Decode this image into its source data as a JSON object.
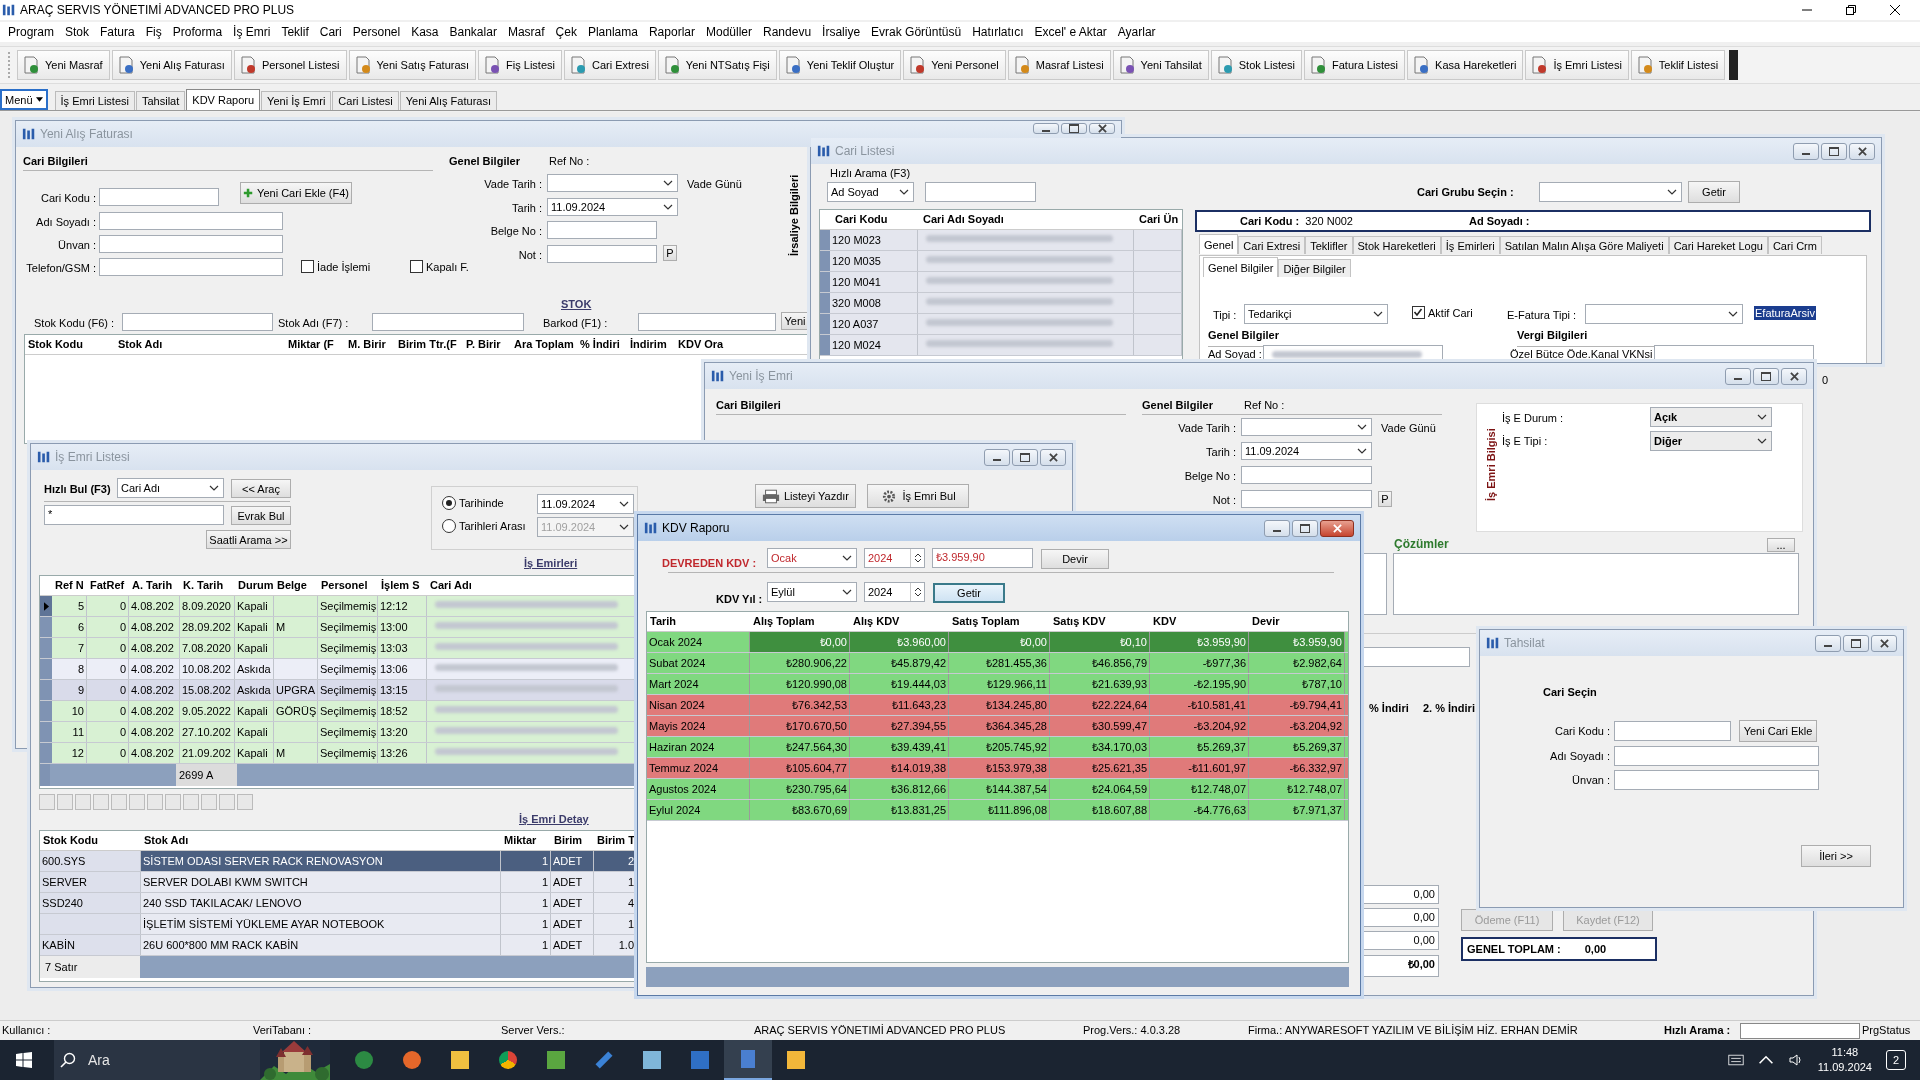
{
  "app_title": "ARAÇ SERVIS YÖNETIMİ ADVANCED PRO PLUS",
  "menu": [
    "Program",
    "Stok",
    "Fatura",
    "Fiş",
    "Proforma",
    "İş Emri",
    "Teklif",
    "Cari",
    "Personel",
    "Kasa",
    "Bankalar",
    "Masraf",
    "Çek",
    "Planlama",
    "Raporlar",
    "Modüller",
    "Randevu",
    "İrsaliye",
    "Evrak Görüntüsü",
    "Hatırlatıcı",
    "Excel' e Aktar",
    "Ayarlar"
  ],
  "toolbar": [
    "Yeni Masraf",
    "Yeni Alış Faturası",
    "Personel Listesi",
    "Yeni Satış Faturası",
    "Fiş Listesi",
    "Cari Extresi",
    "Yeni NTSatış Fişi",
    "Yeni Teklif Oluştur",
    "Yeni Personel",
    "Masraf Listesi",
    "Yeni Tahsilat",
    "Stok Listesi",
    "Fatura Listesi",
    "Kasa Hareketleri",
    "İş Emri Listesi",
    "Teklif Listesi"
  ],
  "menu_button": "Menü",
  "tabs": [
    {
      "label": "İş Emri Listesi",
      "selected": false
    },
    {
      "label": "Tahsilat",
      "selected": false
    },
    {
      "label": "KDV Raporu",
      "selected": true
    },
    {
      "label": "Yeni İş Emri",
      "selected": false
    },
    {
      "label": "Cari Listesi",
      "selected": false
    },
    {
      "label": "Yeni Alış Faturası",
      "selected": false
    }
  ],
  "windows": [
    {
      "kind": "purchase_invoice",
      "title": "Yeni Alış Faturası",
      "active": false,
      "items": [
        {
          "kind": "heading",
          "text": "Cari Bilgileri"
        },
        {
          "kind": "label",
          "text": "Cari Kodu :"
        },
        {
          "kind": "field"
        },
        {
          "kind": "label",
          "text": "Adı Soyadı :"
        },
        {
          "kind": "field"
        },
        {
          "kind": "label",
          "text": "Ünvan :"
        },
        {
          "kind": "field"
        },
        {
          "kind": "label",
          "text": "Telefon/GSM :"
        },
        {
          "kind": "field"
        },
        {
          "kind": "add_button",
          "text": "Yeni Cari Ekle (F4)"
        },
        {
          "kind": "checkbox",
          "text": "İade İşlemi",
          "checked": false
        },
        {
          "kind": "checkbox",
          "text": "Kapalı F.",
          "checked": false
        },
        {
          "kind": "heading",
          "text": "Genel Bilgiler"
        },
        {
          "kind": "label",
          "text": "Ref No :"
        },
        {
          "kind": "label",
          "text": "Vade Tarih :"
        },
        {
          "kind": "dropdown"
        },
        {
          "kind": "label",
          "text": "Vade Günü"
        },
        {
          "kind": "label",
          "text": "Tarih :"
        },
        {
          "kind": "dropdown",
          "value": "11.09.2024"
        },
        {
          "kind": "label",
          "text": "Belge No :"
        },
        {
          "kind": "field"
        },
        {
          "kind": "label",
          "text": "Not :"
        },
        {
          "kind": "field"
        },
        {
          "kind": "button",
          "text": "P"
        },
        {
          "kind": "vlabel",
          "text": "İrsaliye Bilgileri"
        },
        {
          "kind": "link",
          "text": "STOK"
        },
        {
          "kind": "label",
          "text": "Stok Kodu (F6) :"
        },
        {
          "kind": "field"
        },
        {
          "kind": "label",
          "text": "Stok Adı (F7) :"
        },
        {
          "kind": "field"
        },
        {
          "kind": "label",
          "text": "Barkod (F1) :"
        },
        {
          "kind": "field"
        },
        {
          "kind": "button",
          "text": "Yeni"
        }
      ],
      "columns": [
        "Stok Kodu",
        "Stok Adı",
        "Miktar (F",
        "M. Birir",
        "Birim Ttr.(F",
        "P. Birir",
        "Ara Toplam",
        "% İndiri",
        "İndirim",
        "KDV Ora"
      ]
    },
    {
      "kind": "customer_list",
      "title": "Cari Listesi",
      "active": false,
      "items": [
        {
          "kind": "group_label",
          "text": "Hızlı Arama (F3)"
        },
        {
          "kind": "dropdown",
          "value": "Ad Soyad"
        },
        {
          "kind": "field"
        },
        {
          "kind": "heading",
          "text": "Cari Grubu Seçin :"
        },
        {
          "kind": "dropdown"
        },
        {
          "kind": "button",
          "text": "Getir"
        },
        {
          "kind": "label",
          "text": "Tipi :"
        },
        {
          "kind": "dropdown",
          "value": "Tedarikçi"
        },
        {
          "kind": "checkbox",
          "text": "Aktif Cari",
          "checked": true
        },
        {
          "kind": "label",
          "text": "E-Fatura Tipi :"
        },
        {
          "kind": "dropdown"
        },
        {
          "kind": "marked",
          "text": "EfaturaArsiv"
        },
        {
          "kind": "heading",
          "text": "Genel Bilgiler"
        },
        {
          "kind": "heading",
          "text": "Vergi Bilgileri"
        },
        {
          "kind": "label",
          "text": "Ad Soyad :"
        },
        {
          "kind": "field",
          "redacted": true
        },
        {
          "kind": "label",
          "text": "Özel Bütce Öde.Kanal VKNsi"
        },
        {
          "kind": "field"
        }
      ],
      "columns": [
        "Cari Kodu",
        "Cari Adı Soyadı",
        "Cari Ün"
      ],
      "rows": [
        "120 M023",
        "120 M035",
        "120 M041",
        "320 M008",
        "120 A037",
        "120 M024"
      ],
      "card": {
        "code_label": "Cari Kodu :",
        "code": "320 N002",
        "name_label": "Ad Soyadı :"
      },
      "tabs": [
        {
          "label": "Genel",
          "selected": true
        },
        {
          "label": "Cari Extresi",
          "selected": false
        },
        {
          "label": "Teklifler",
          "selected": false
        },
        {
          "label": "Stok Hareketleri",
          "selected": false
        },
        {
          "label": "İş Emirleri",
          "selected": false
        },
        {
          "label": "Satılan Malın Alışa Göre Maliyeti",
          "selected": false
        },
        {
          "label": "Cari Hareket Logu",
          "selected": false
        },
        {
          "label": "Cari Crm",
          "selected": false
        }
      ],
      "subtabs": [
        {
          "label": "Genel Bilgiler",
          "selected": true
        },
        {
          "label": "Diğer Bilgiler",
          "selected": false
        }
      ]
    },
    {
      "kind": "work_order",
      "title": "Yeni İş Emri",
      "active": false,
      "items": [
        {
          "kind": "heading",
          "text": "Cari Bilgileri"
        },
        {
          "kind": "heading",
          "text": "Genel Bilgiler"
        },
        {
          "kind": "label",
          "text": "Ref No :"
        },
        {
          "kind": "label",
          "text": "Vade Tarih :"
        },
        {
          "kind": "dropdown"
        },
        {
          "kind": "label",
          "text": "Vade Günü"
        },
        {
          "kind": "label",
          "text": "Tarih :"
        },
        {
          "kind": "dropdown",
          "value": "11.09.2024"
        },
        {
          "kind": "label",
          "text": "Belge No :"
        },
        {
          "kind": "field"
        },
        {
          "kind": "label",
          "text": "Not :"
        },
        {
          "kind": "field"
        },
        {
          "kind": "button",
          "text": "P"
        },
        {
          "kind": "vlabel",
          "text": "İş Emri Bilgisi"
        },
        {
          "kind": "label",
          "text": "İş E Durum :"
        },
        {
          "kind": "dropdown",
          "value": "Açık"
        },
        {
          "kind": "label",
          "text": "İş E Tipi :"
        },
        {
          "kind": "dropdown",
          "value": "Diğer"
        },
        {
          "kind": "green_heading",
          "text": "Çözümler"
        },
        {
          "kind": "button",
          "text": "..."
        },
        {
          "kind": "field"
        },
        {
          "kind": "field"
        },
        {
          "kind": "field"
        },
        {
          "kind": "heading",
          "text": "% İndiri"
        },
        {
          "kind": "heading",
          "text": "2. % İndiri"
        },
        {
          "kind": "field",
          "value": "0,00"
        },
        {
          "kind": "field",
          "value": "0,00"
        },
        {
          "kind": "field",
          "value": "0,00"
        },
        {
          "kind": "field",
          "value": "₺0,00"
        },
        {
          "kind": "button",
          "text": "Ödeme (F11)",
          "disabled": true
        },
        {
          "kind": "button",
          "text": "Kaydet (F12)",
          "disabled": true
        },
        {
          "kind": "total",
          "text": "GENEL TOPLAM :",
          "value": "0,00"
        }
      ]
    },
    {
      "kind": "work_order_list",
      "title": "İş Emri Listesi",
      "active": false,
      "items": [
        {
          "kind": "heading",
          "text": "Hızlı Bul (F3)"
        },
        {
          "kind": "dropdown",
          "value": "Cari Adı"
        },
        {
          "kind": "button",
          "text": "<< Araç"
        },
        {
          "kind": "field",
          "value": "*"
        },
        {
          "kind": "button",
          "text": "Evrak Bul"
        },
        {
          "kind": "button",
          "text": "Saatli Arama >>"
        },
        {
          "kind": "radio",
          "text": "Tarihinde",
          "selected": true
        },
        {
          "kind": "radio",
          "text": "Tarihleri Arası",
          "selected": false
        },
        {
          "kind": "dropdown",
          "value": "11.09.2024"
        },
        {
          "kind": "dropdown",
          "value": "11.09.2024",
          "disabled": true
        },
        {
          "kind": "print_button",
          "text": "Listeyi Yazdır"
        },
        {
          "kind": "search_button",
          "text": "İş Emri Bul"
        },
        {
          "kind": "link",
          "text": "İş Emirleri"
        },
        {
          "kind": "link",
          "text": "İş Emri Detay"
        }
      ],
      "columns": [
        "Ref N",
        "FatRef",
        "A. Tarih",
        "K. Tarih",
        "Durum",
        "Belge",
        "Personel",
        "İşlem S",
        "Cari Adı"
      ],
      "rows": [
        {
          "selected": true,
          "color": "#d8f1d3",
          "cells": [
            "5",
            "0",
            "4.08.202",
            "8.09.2020",
            "Kapali",
            "",
            "Seçilmemiş",
            "12:12"
          ]
        },
        {
          "selected": false,
          "color": "#d8f1d3",
          "cells": [
            "6",
            "0",
            "4.08.202",
            "28.09.202",
            "Kapali",
            "M",
            "Seçilmemiş",
            "13:00"
          ]
        },
        {
          "selected": false,
          "color": "#d8f1d3",
          "cells": [
            "7",
            "0",
            "4.08.202",
            "7.08.2020",
            "Kapali",
            "",
            "Seçilmemiş",
            "13:03"
          ]
        },
        {
          "selected": false,
          "color": "#eceef7",
          "cells": [
            "8",
            "0",
            "4.08.202",
            "10.08.202",
            "Askıda",
            "",
            "Seçilmemiş",
            "13:06"
          ]
        },
        {
          "selected": false,
          "color": "#d9dbea",
          "cells": [
            "9",
            "0",
            "4.08.202",
            "15.08.202",
            "Askıda",
            "UPGRA",
            "Seçilmemiş",
            "13:15"
          ]
        },
        {
          "selected": false,
          "color": "#d8f1d3",
          "cells": [
            "10",
            "0",
            "4.08.202",
            "9.05.2022",
            "Kapali",
            "GÖRÜŞ",
            "Seçilmemiş",
            "18:52"
          ]
        },
        {
          "selected": false,
          "color": "#d8f1d3",
          "cells": [
            "11",
            "0",
            "4.08.202",
            "27.10.202",
            "Kapali",
            "",
            "Seçilmemiş",
            "13:20"
          ]
        },
        {
          "selected": false,
          "color": "#d8f1d3",
          "cells": [
            "12",
            "0",
            "4.08.202",
            "21.09.202",
            "Kapali",
            "M",
            "Seçilmemiş",
            "13:26"
          ]
        }
      ],
      "count": "2699 A",
      "detail_columns": [
        "Stok Kodu",
        "Stok Adı",
        "Miktar",
        "Birim",
        "Birim T"
      ],
      "detail_rows": [
        {
          "selected": true,
          "cells": [
            "600.SYS",
            "SİSTEM ODASI SERVER RACK RENOVASYON",
            "1",
            "ADET",
            "2"
          ]
        },
        {
          "selected": false,
          "cells": [
            "SERVER",
            "SERVER DOLABI KWM SWITCH",
            "1",
            "ADET",
            "1"
          ]
        },
        {
          "selected": false,
          "cells": [
            "SSD240",
            "240 SSD TAKILACAK/ LENOVO",
            "1",
            "ADET",
            "4"
          ]
        },
        {
          "selected": false,
          "cells": [
            "",
            "İŞLETİM SİSTEMİ YÜKLEME AYAR NOTEBOOK",
            "1",
            "ADET",
            "1"
          ]
        },
        {
          "selected": false,
          "cells": [
            "KABİN",
            "26U 600*800 MM RACK KABİN",
            "1",
            "ADET",
            "1.0"
          ]
        }
      ],
      "detail_count": "7 Satır"
    },
    {
      "kind": "vat_report",
      "title": "KDV Raporu",
      "active": true,
      "items": [
        {
          "kind": "red_heading",
          "text": "DEVREDEN KDV :"
        },
        {
          "kind": "dropdown",
          "value": "Ocak",
          "warning": true
        },
        {
          "kind": "spin",
          "value": "2024",
          "warning": true
        },
        {
          "kind": "field",
          "value": "₺3.959,90",
          "warning": true
        },
        {
          "kind": "button",
          "text": "Devir"
        },
        {
          "kind": "heading",
          "text": "KDV Yıl :"
        },
        {
          "kind": "dropdown",
          "value": "Eylül"
        },
        {
          "kind": "spin",
          "value": "2024"
        },
        {
          "kind": "button",
          "text": "Getir",
          "focused": true
        }
      ],
      "columns": [
        "Tarih",
        "Alış Toplam",
        "Alış KDV",
        "Satış Toplam",
        "Satış KDV",
        "KDV",
        "Devir"
      ],
      "rows": [
        {
          "selected": true,
          "color": "#80d880",
          "cells": [
            "Ocak 2024",
            "₺0,00",
            "₺3.960,00",
            "₺0,00",
            "₺0,10",
            "₺3.959,90",
            "₺3.959,90"
          ]
        },
        {
          "selected": false,
          "color": "#80d880",
          "cells": [
            "Subat 2024",
            "₺280.906,22",
            "₺45.879,42",
            "₺281.455,36",
            "₺46.856,79",
            "-₺977,36",
            "₺2.982,64"
          ]
        },
        {
          "selected": false,
          "color": "#80d880",
          "cells": [
            "Mart 2024",
            "₺120.990,08",
            "₺19.444,03",
            "₺129.966,11",
            "₺21.639,93",
            "-₺2.195,90",
            "₺787,10"
          ]
        },
        {
          "selected": false,
          "color": "#e07a7a",
          "cells": [
            "Nisan 2024",
            "₺76.342,53",
            "₺11.643,23",
            "₺134.245,80",
            "₺22.224,64",
            "-₺10.581,41",
            "-₺9.794,41"
          ]
        },
        {
          "selected": false,
          "color": "#e07a7a",
          "cells": [
            "Mayis 2024",
            "₺170.670,50",
            "₺27.394,55",
            "₺364.345,28",
            "₺30.599,47",
            "-₺3.204,92",
            "-₺3.204,92"
          ]
        },
        {
          "selected": false,
          "color": "#80d880",
          "cells": [
            "Haziran 2024",
            "₺247.564,30",
            "₺39.439,41",
            "₺205.745,92",
            "₺34.170,03",
            "₺5.269,37",
            "₺5.269,37"
          ]
        },
        {
          "selected": false,
          "color": "#e07a7a",
          "cells": [
            "Temmuz 2024",
            "₺105.604,77",
            "₺14.019,38",
            "₺153.979,38",
            "₺25.621,35",
            "-₺11.601,97",
            "-₺6.332,97"
          ]
        },
        {
          "selected": false,
          "color": "#80d880",
          "cells": [
            "Agustos 2024",
            "₺230.795,64",
            "₺36.812,66",
            "₺144.387,54",
            "₺24.064,59",
            "₺12.748,07",
            "₺12.748,07"
          ]
        },
        {
          "selected": false,
          "color": "#80d880",
          "cells": [
            "Eylul 2024",
            "₺83.670,69",
            "₺13.831,25",
            "₺111.896,08",
            "₺18.607,88",
            "-₺4.776,63",
            "₺7.971,37"
          ]
        }
      ]
    },
    {
      "kind": "collection",
      "title": "Tahsilat",
      "active": false,
      "items": [
        {
          "kind": "heading",
          "text": "Cari Seçin"
        },
        {
          "kind": "label",
          "text": "Cari Kodu :"
        },
        {
          "kind": "field"
        },
        {
          "kind": "button",
          "text": "Yeni Cari Ekle"
        },
        {
          "kind": "label",
          "text": "Adı Soyadı :"
        },
        {
          "kind": "field"
        },
        {
          "kind": "label",
          "text": "Ünvan :"
        },
        {
          "kind": "field"
        },
        {
          "kind": "button",
          "text": "İleri >>"
        }
      ]
    }
  ],
  "stray_value": "0",
  "status": [
    "Kullanıcı :",
    "VeriTabanı :",
    "Server Vers.:",
    "ARAÇ SERVIS YÖNETIMİ ADVANCED PRO PLUS",
    "Prog.Vers.: 4.0.3.28",
    "Firma.: ANYWARESOFT YAZILIM VE BİLİŞİM HİZ. ERHAN DEMİR"
  ],
  "quick_search_label": "Hızlı Arama :",
  "status_end": "PrgStatus",
  "taskbar": {
    "search_placeholder": "Ara",
    "time": "11:48",
    "date": "11.09.2024",
    "notifications": "2"
  }
}
